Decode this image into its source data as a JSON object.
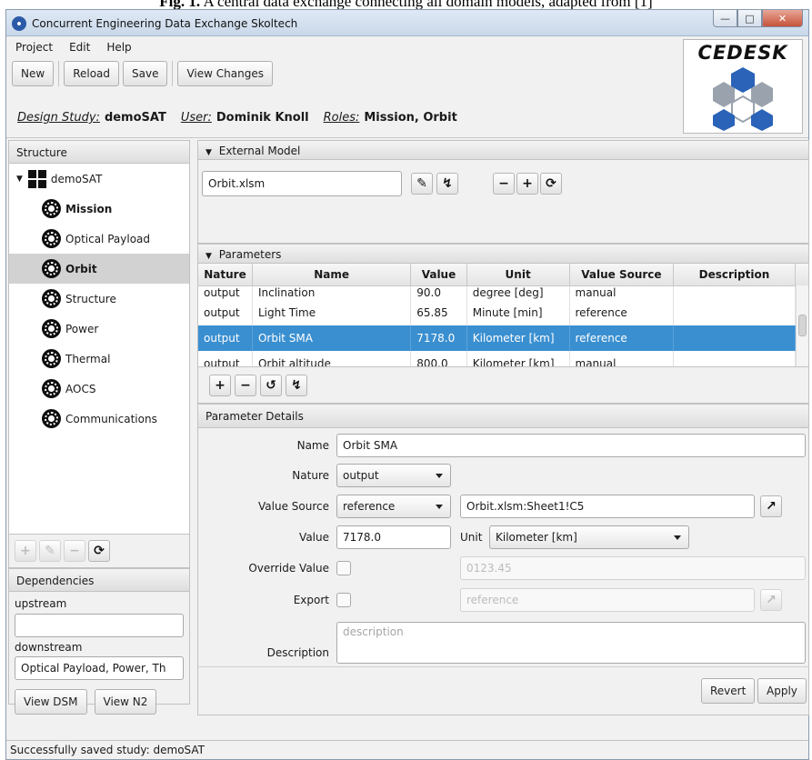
{
  "caption": {
    "label": "Fig. 1.",
    "text": "A central data exchange connecting all domain models, adapted from [1]"
  },
  "window": {
    "title": "Concurrent Engineering Data Exchange Skoltech",
    "controls": [
      "minimize",
      "maximize",
      "close"
    ]
  },
  "menu": [
    "Project",
    "Edit",
    "Help"
  ],
  "toolbar": {
    "new": "New",
    "reload": "Reload",
    "save": "Save",
    "view_changes": "View Changes"
  },
  "info": {
    "design_study_label": "Design Study:",
    "design_study": "demoSAT",
    "user_label": "User:",
    "user": "Dominik Knoll",
    "roles_label": "Roles:",
    "roles": "Mission, Orbit"
  },
  "logo": {
    "text": "CEDESK"
  },
  "structure": {
    "title": "Structure",
    "root": "demoSAT",
    "items": [
      {
        "label": "Mission",
        "bold": true
      },
      {
        "label": "Optical Payload"
      },
      {
        "label": "Orbit",
        "bold": true,
        "selected": true
      },
      {
        "label": "Structure"
      },
      {
        "label": "Power"
      },
      {
        "label": "Thermal"
      },
      {
        "label": "AOCS"
      },
      {
        "label": "Communications"
      }
    ]
  },
  "dependencies": {
    "title": "Dependencies",
    "upstream_label": "upstream",
    "upstream_value": "",
    "downstream_label": "downstream",
    "downstream_value": "Optical Payload, Power, Th",
    "view_dsm": "View DSM",
    "view_n2": "View N2"
  },
  "external_model": {
    "title": "External Model",
    "file": "Orbit.xlsm"
  },
  "parameters": {
    "title": "Parameters",
    "columns": [
      "Nature",
      "Name",
      "Value",
      "Unit",
      "Value Source",
      "Description"
    ],
    "rows": [
      [
        "output",
        "Inclination",
        "90.0",
        "degree [deg]",
        "manual",
        ""
      ],
      [
        "output",
        "Light Time",
        "65.85",
        "Minute [min]",
        "reference",
        ""
      ],
      [
        "output",
        "Orbit SMA",
        "7178.0",
        "Kilometer [km]",
        "reference",
        ""
      ],
      [
        "output",
        "Orbit altitude",
        "800.0",
        "Kilometer [km]",
        "manual",
        ""
      ]
    ],
    "selected_row": 2
  },
  "details": {
    "title": "Parameter Details",
    "name_label": "Name",
    "name": "Orbit SMA",
    "nature_label": "Nature",
    "nature": "output",
    "value_source_label": "Value Source",
    "value_source": "reference",
    "source_ref": "Orbit.xlsm:Sheet1!C5",
    "value_label": "Value",
    "value": "7178.0",
    "unit_label": "Unit",
    "unit": "Kilometer [km]",
    "override_label": "Override Value",
    "override_placeholder": "0123.45",
    "export_label": "Export",
    "export_placeholder": "reference",
    "description_label": "Description",
    "description_placeholder": "description",
    "revert": "Revert",
    "apply": "Apply"
  },
  "status": "Successfully saved study: demoSAT"
}
